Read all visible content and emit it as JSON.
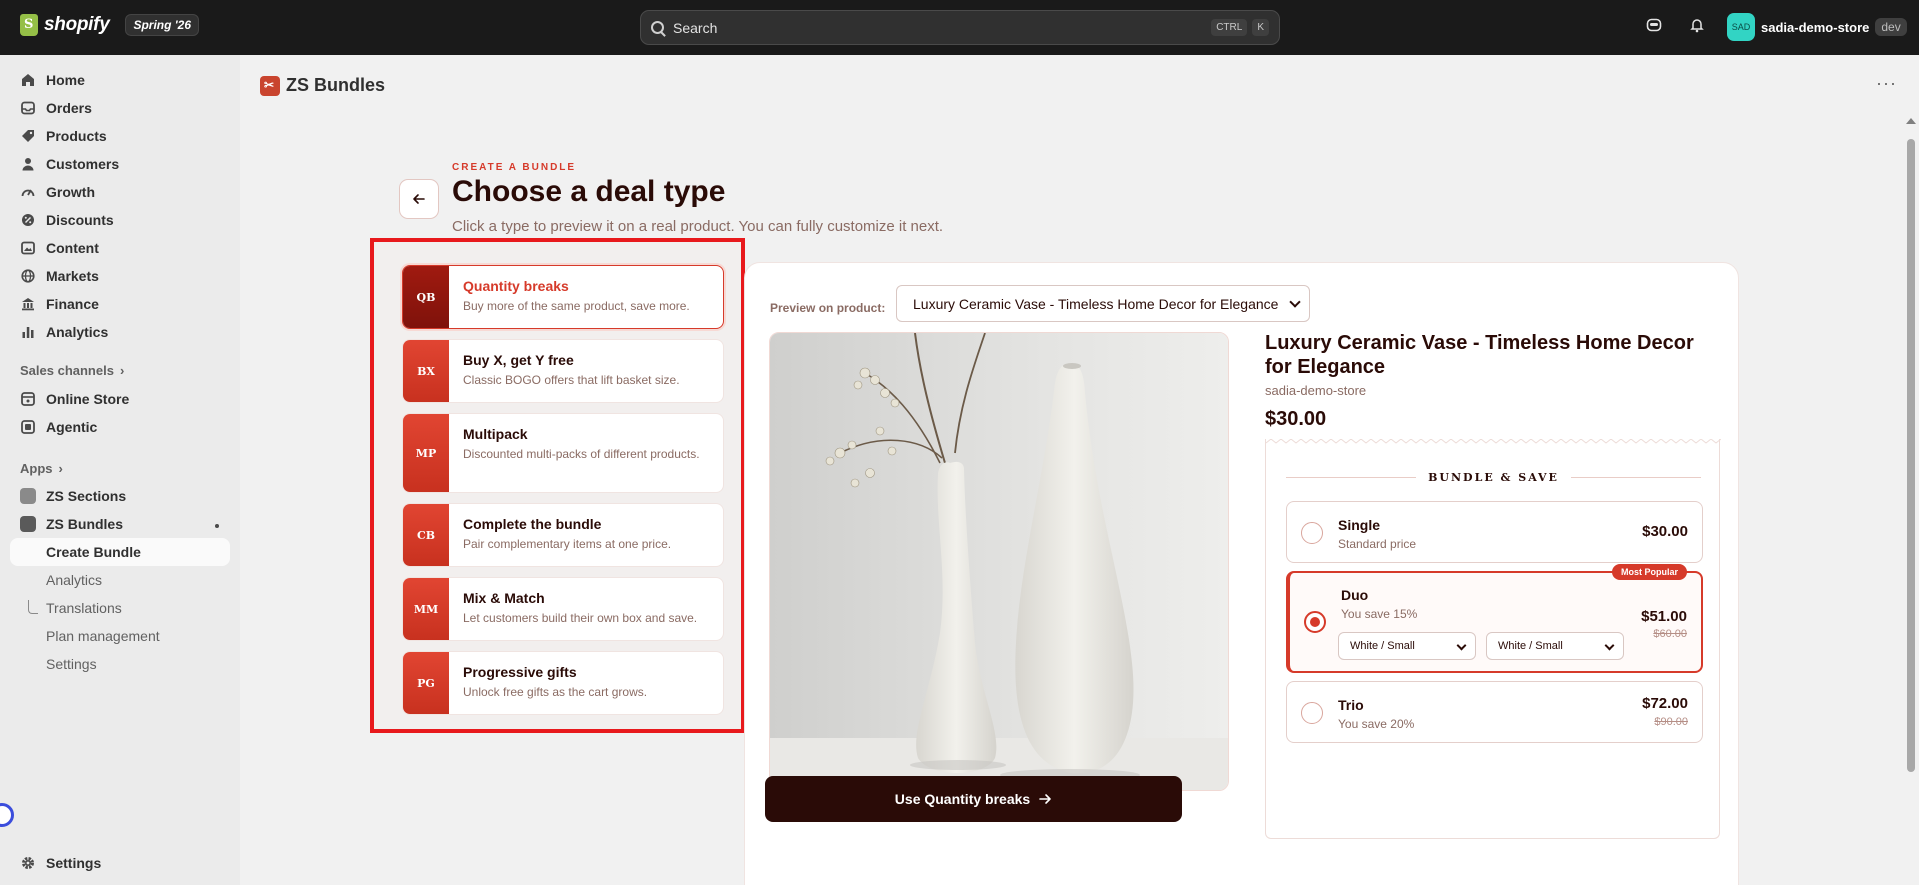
{
  "topbar": {
    "brand": "shopify",
    "edition_badge": "Spring '26",
    "search_placeholder": "Search",
    "shortcut_ctrl": "CTRL",
    "shortcut_key": "K",
    "store_initials": "SAD",
    "store_name": "sadia-demo-store",
    "store_env": "dev"
  },
  "sidebar": {
    "items": [
      {
        "label": "Home",
        "icon": "home-icon"
      },
      {
        "label": "Orders",
        "icon": "inbox-icon"
      },
      {
        "label": "Products",
        "icon": "tag-icon"
      },
      {
        "label": "Customers",
        "icon": "person-icon"
      },
      {
        "label": "Growth",
        "icon": "gauge-icon"
      },
      {
        "label": "Discounts",
        "icon": "discount-icon"
      },
      {
        "label": "Content",
        "icon": "image-icon"
      },
      {
        "label": "Markets",
        "icon": "globe-icon"
      },
      {
        "label": "Finance",
        "icon": "bank-icon"
      },
      {
        "label": "Analytics",
        "icon": "bar-chart-icon"
      }
    ],
    "sales_channels_heading": "Sales channels",
    "channels": [
      {
        "label": "Online Store",
        "icon": "store-icon"
      },
      {
        "label": "Agentic",
        "icon": "agent-icon"
      }
    ],
    "apps_heading": "Apps",
    "apps": [
      {
        "label": "ZS Sections"
      },
      {
        "label": "ZS Bundles"
      }
    ],
    "app_subitems": [
      "Create Bundle",
      "Analytics",
      "Translations",
      "Plan management",
      "Settings"
    ],
    "settings_label": "Settings"
  },
  "main": {
    "app_title": "ZS Bundles",
    "more_label": "···",
    "eyebrow": "CREATE A BUNDLE",
    "title": "Choose a deal type",
    "subtitle": "Click a type to preview it on a real product. You can fully customize it next.",
    "back_icon": "arrow-left-icon"
  },
  "deals": [
    {
      "abbr": "QB",
      "name": "Quantity breaks",
      "desc": "Buy more of the same product, save more.",
      "selected": true
    },
    {
      "abbr": "BX",
      "name": "Buy X, get Y free",
      "desc": "Classic BOGO offers that lift basket size.",
      "selected": false
    },
    {
      "abbr": "MP",
      "name": "Multipack",
      "desc": "Discounted multi-packs of different products.",
      "selected": false
    },
    {
      "abbr": "CB",
      "name": "Complete the bundle",
      "desc": "Pair complementary items at one price.",
      "selected": false
    },
    {
      "abbr": "MM",
      "name": "Mix & Match",
      "desc": "Let customers build their own box and save.",
      "selected": false
    },
    {
      "abbr": "PG",
      "name": "Progressive gifts",
      "desc": "Unlock free gifts as the cart grows.",
      "selected": false
    }
  ],
  "preview": {
    "label": "Preview on product:",
    "selected_product": "Luxury Ceramic Vase - Timeless Home Decor for Elegance",
    "product_title": "Luxury Ceramic Vase - Timeless Home Decor for Elegance",
    "store": "sadia-demo-store",
    "price": "$30.00",
    "bundle_heading": "BUNDLE & SAVE",
    "options": [
      {
        "name": "Single",
        "sub": "Standard price",
        "price": "$30.00",
        "old_price": "",
        "badge": "",
        "selected": false
      },
      {
        "name": "Duo",
        "sub": "You save 15%",
        "price": "$51.00",
        "old_price": "$60.00",
        "badge": "Most Popular",
        "selected": true,
        "variants": [
          "White / Small",
          "White / Small"
        ]
      },
      {
        "name": "Trio",
        "sub": "You save 20%",
        "price": "$72.00",
        "old_price": "$90.00",
        "badge": "",
        "selected": false
      }
    ],
    "cta_label": "Use Quantity breaks",
    "cta_icon": "arrow-right-icon"
  },
  "colors": {
    "accent": "#d63a2a",
    "dark": "#2a0b07",
    "highlight_frame": "#e8191c"
  }
}
